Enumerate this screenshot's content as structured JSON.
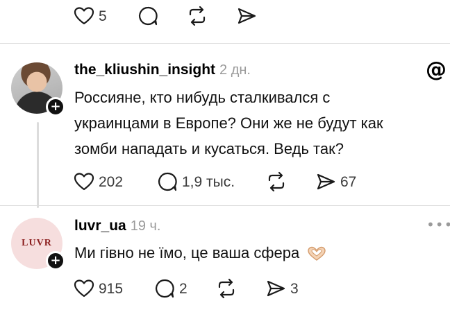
{
  "top_actions": {
    "like_icon": "heart-icon",
    "like_count": "5",
    "reply_icon": "comment-icon",
    "repost_icon": "repost-icon",
    "share_icon": "send-icon"
  },
  "post": {
    "username": "the_kliushin_insight",
    "time": "2 дн.",
    "text_lines": [
      "Россияне, кто нибудь сталкивался с",
      "украинцами в Европе? Они же не будут как",
      "зомби нападать и кусаться. Ведь так?"
    ],
    "badge_icon": "threads-logo-icon",
    "badge_glyph": "@",
    "avatar_icon": "user-photo-avatar",
    "follow_glyph": "+",
    "likes": "202",
    "replies": "1,9 тыс.",
    "shares": "67"
  },
  "reply": {
    "username": "luvr_ua",
    "time": "19 ч.",
    "text": "Ми гівно не їмо, це ваша сфера",
    "emoji_icon": "heart-hands-emoji",
    "avatar_text": "LUVR",
    "follow_glyph": "+",
    "more_label": "•••",
    "likes": "915",
    "replies": "2",
    "shares": "3"
  }
}
